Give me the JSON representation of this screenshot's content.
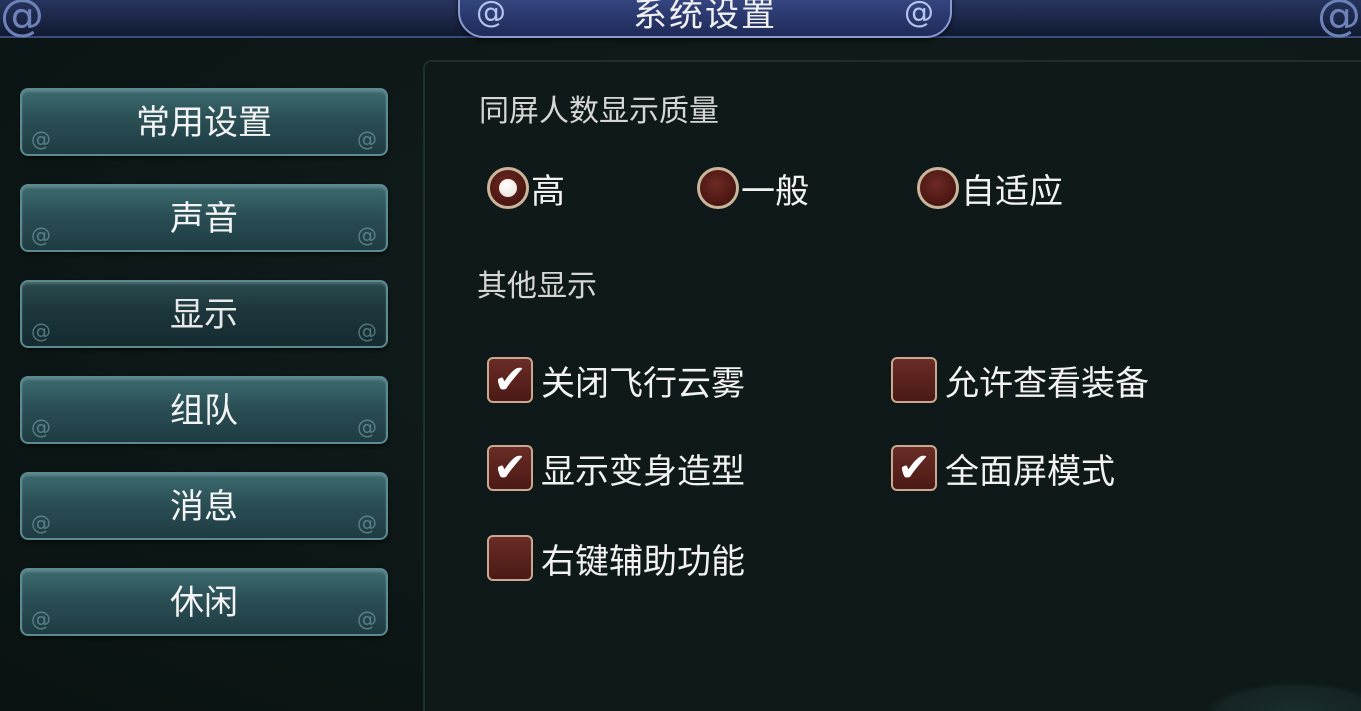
{
  "window": {
    "title": "系统设置"
  },
  "sidebar": {
    "items": [
      {
        "label": "常用设置",
        "active": false
      },
      {
        "label": "声音",
        "active": false
      },
      {
        "label": "显示",
        "active": true
      },
      {
        "label": "组队",
        "active": false
      },
      {
        "label": "消息",
        "active": false
      },
      {
        "label": "休闲",
        "active": false
      }
    ]
  },
  "display": {
    "quality_section": {
      "title": "同屏人数显示质量",
      "options": [
        {
          "label": "高",
          "selected": true
        },
        {
          "label": "一般",
          "selected": false
        },
        {
          "label": "自适应",
          "selected": false
        }
      ]
    },
    "other_section": {
      "title": "其他显示",
      "options": [
        {
          "label": "关闭飞行云雾",
          "checked": true
        },
        {
          "label": "允许查看装备",
          "checked": false
        },
        {
          "label": "显示变身造型",
          "checked": true
        },
        {
          "label": "全面屏模式",
          "checked": true
        },
        {
          "label": "右键辅助功能",
          "checked": false
        }
      ]
    }
  },
  "colors": {
    "accent_plate": "#2b3a70",
    "button_teal": "#2a4f55",
    "control_red": "#5a1e19",
    "control_border": "#c9b59a"
  },
  "icons": {
    "checkmark": "✔",
    "swirl": "໑"
  }
}
